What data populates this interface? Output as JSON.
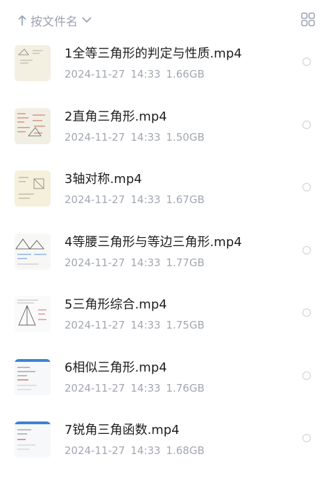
{
  "toolbar": {
    "sort_label": "按文件名",
    "sort_icon": "arrow-up-icon",
    "dropdown_icon": "chevron-down-icon",
    "view_icon": "grid-view-icon"
  },
  "files": [
    {
      "name": "1全等三角形的判定与性质.mp4",
      "date": "2024-11-27",
      "time": "14:33",
      "size": "1.66GB"
    },
    {
      "name": "2直角三角形.mp4",
      "date": "2024-11-27",
      "time": "14:33",
      "size": "1.50GB"
    },
    {
      "name": "3轴对称.mp4",
      "date": "2024-11-27",
      "time": "14:33",
      "size": "1.67GB"
    },
    {
      "name": "4等腰三角形与等边三角形.mp4",
      "date": "2024-11-27",
      "time": "14:33",
      "size": "1.77GB"
    },
    {
      "name": "5三角形综合.mp4",
      "date": "2024-11-27",
      "time": "14:33",
      "size": "1.75GB"
    },
    {
      "name": "6相似三角形.mp4",
      "date": "2024-11-27",
      "time": "14:33",
      "size": "1.76GB"
    },
    {
      "name": "7锐角三角函数.mp4",
      "date": "2024-11-27",
      "time": "14:33",
      "size": "1.68GB"
    }
  ]
}
